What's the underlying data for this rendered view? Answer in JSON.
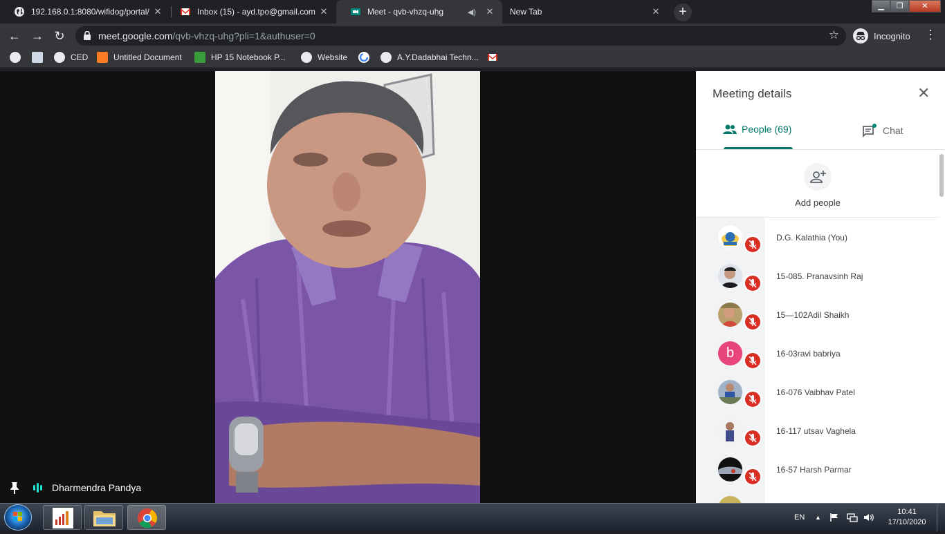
{
  "browser": {
    "tabs": [
      {
        "title": "192.168.0.1:8080/wifidog/portal/",
        "icon": "globe-icon"
      },
      {
        "title": "Inbox (15) - ayd.tpo@gmail.com",
        "icon": "gmail-icon"
      },
      {
        "title": "Meet - qvb-vhzq-uhg",
        "icon": "meet-icon",
        "active": true,
        "audio": true
      },
      {
        "title": "New Tab",
        "icon": "none"
      }
    ],
    "url_host": "meet.google.com",
    "url_path": "/qvb-vhzq-uhg?pli=1&authuser=0",
    "incognito_label": "Incognito",
    "bookmarks": [
      {
        "label": "",
        "icon": "globe-icon"
      },
      {
        "label": "",
        "icon": "app-icon"
      },
      {
        "label": "CED",
        "icon": "globe-icon"
      },
      {
        "label": "Untitled Document",
        "icon": "xampp-icon"
      },
      {
        "label": "HP 15 Notebook P...",
        "icon": "hp-icon"
      },
      {
        "label": "Website",
        "icon": "globe-icon"
      },
      {
        "label": "",
        "icon": "google-icon"
      },
      {
        "label": "A.Y.Dadabhai Techn...",
        "icon": "globe-icon"
      },
      {
        "label": "",
        "icon": "gmail-icon"
      }
    ]
  },
  "meet": {
    "presenter_name": "Dharmendra Pandya",
    "panel": {
      "title": "Meeting details",
      "people_tab": "People (69)",
      "chat_tab": "Chat",
      "add_people": "Add people",
      "participants": [
        {
          "name": "D.G. Kalathia (You)",
          "avatar": "logo"
        },
        {
          "name": "15-085. Pranavsinh Raj",
          "avatar": "photo"
        },
        {
          "name": "15—102Adil Shaikh",
          "avatar": "photo"
        },
        {
          "name": "16-03ravi babriya",
          "avatar": "letter",
          "letter": "b",
          "color": "#e8457a"
        },
        {
          "name": "16-076 Vaibhav Patel",
          "avatar": "photo"
        },
        {
          "name": "16-117 utsav Vaghela",
          "avatar": "photo"
        },
        {
          "name": "16-57 Harsh Parmar",
          "avatar": "photo"
        }
      ]
    }
  },
  "taskbar": {
    "language": "EN",
    "time": "10:41",
    "date": "17/10/2020"
  },
  "colors": {
    "accent": "#00796b",
    "mic_muted": "#d93025",
    "presenter_bars": "#1ee3cf"
  }
}
